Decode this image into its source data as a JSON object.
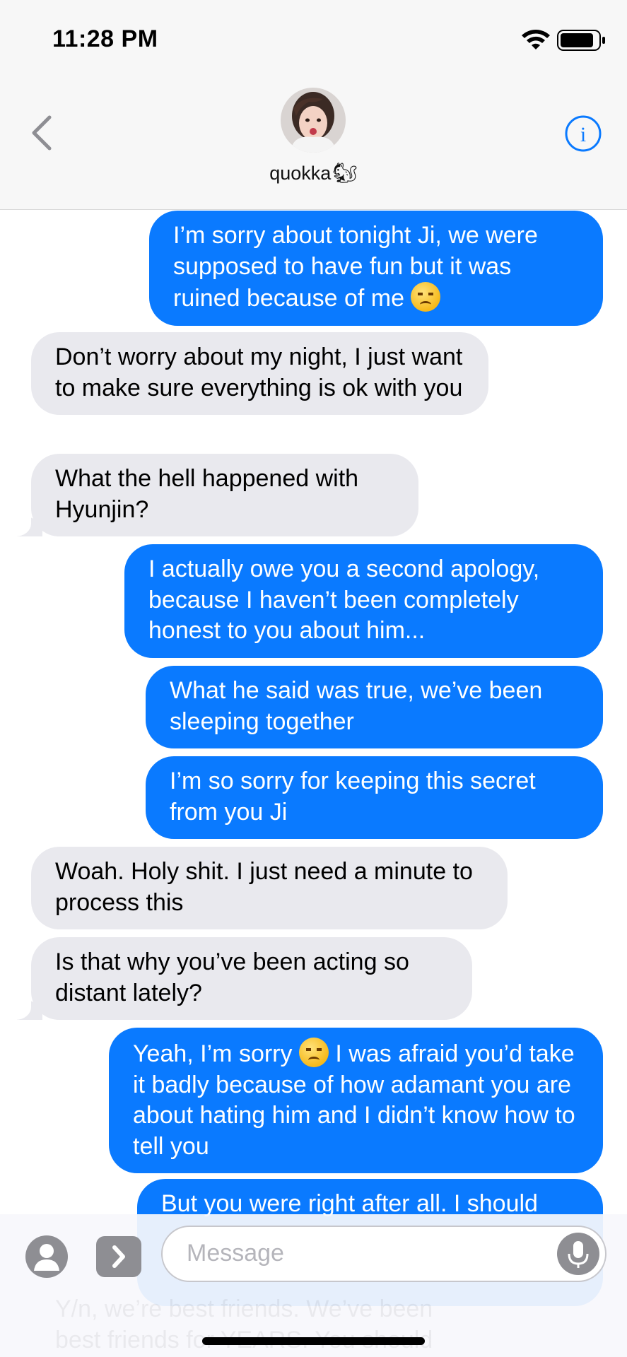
{
  "status_bar": {
    "time": "11:28 PM"
  },
  "header": {
    "contact_name": "quokka",
    "name_emoji": "🐿"
  },
  "messages": [
    {
      "from": "me",
      "text": "I’m sorry about tonight Ji, we were supposed to have fun but it was ruined because of me",
      "emoji": "disappointed-face"
    },
    {
      "from": "them",
      "text": "Don’t worry about my night, I just want to make sure everything is ok with you"
    },
    {
      "from": "them",
      "text": "What the hell happened with Hyunjin?"
    },
    {
      "from": "me",
      "text": "I actually owe you a second apology, because I haven’t been completely honest to you about him..."
    },
    {
      "from": "me",
      "text": "What he said was true, we’ve been sleeping together"
    },
    {
      "from": "me",
      "text": "I’m so sorry for keeping this secret from you Ji"
    },
    {
      "from": "them",
      "text": "Woah. Holy shit. I just need a minute to process this"
    },
    {
      "from": "them",
      "text": "Is that why you’ve been acting so distant lately?"
    },
    {
      "from": "me",
      "text_before_emoji": "Yeah, I’m sorry",
      "text_after_emoji": "I was afraid you’d take it badly because of how adamant you are about hating him and I didn’t know how to tell you",
      "emoji": "pensive-face"
    },
    {
      "from": "me",
      "text": "But you were right after all. I should"
    }
  ],
  "ghost_text": "Y/n, we’re best friends. We’ve been best friends for YEARS. You should",
  "input": {
    "placeholder": "Message"
  },
  "colors": {
    "sent_bubble": "#0a7aff",
    "received_bubble": "#e9e9ee",
    "accent": "#0a7aff"
  }
}
